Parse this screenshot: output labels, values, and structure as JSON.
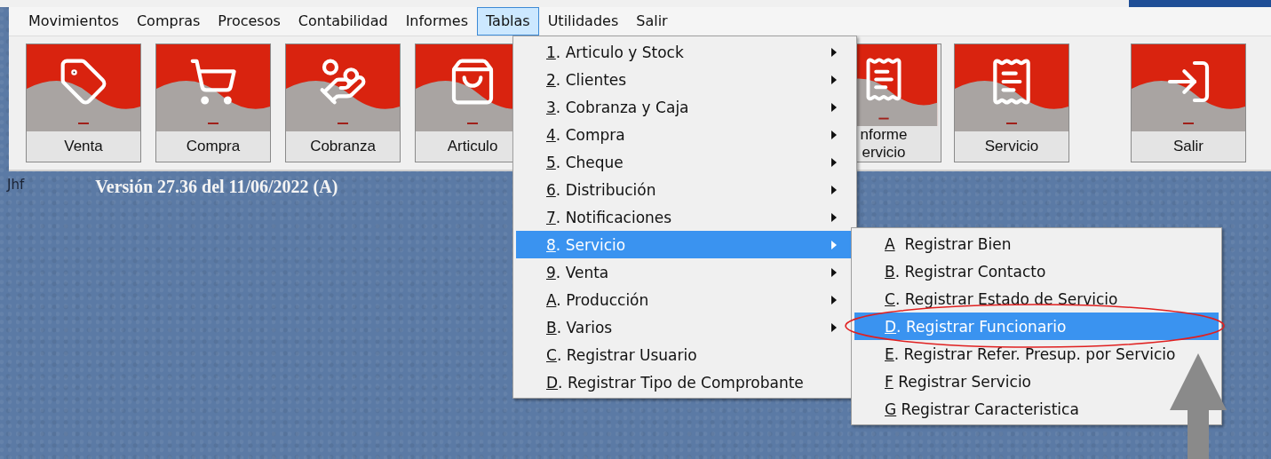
{
  "menu_bar": [
    {
      "label": "Movimientos",
      "selected": false
    },
    {
      "label": "Compras",
      "selected": false
    },
    {
      "label": "Procesos",
      "selected": false
    },
    {
      "label": "Contabilidad",
      "selected": false
    },
    {
      "label": "Informes",
      "selected": false
    },
    {
      "label": "Tablas",
      "selected": true
    },
    {
      "label": "Utilidades",
      "selected": false
    },
    {
      "label": "Salir",
      "selected": false
    }
  ],
  "toolbar": [
    {
      "label": "Venta"
    },
    {
      "label": "Compra"
    },
    {
      "label": "Cobranza"
    },
    {
      "label": "Articulo"
    },
    {
      "label": "nforme\nervicio"
    },
    {
      "label": "Servicio"
    },
    {
      "label": "Salir"
    }
  ],
  "status": {
    "user": "Jhf",
    "version": "Versión 27.36 del 11/06/2022  (A)"
  },
  "tablas_menu": [
    {
      "key": "1",
      "label": ". Articulo y Stock",
      "submenu": true,
      "selected": false
    },
    {
      "key": "2",
      "label": ". Clientes",
      "submenu": true,
      "selected": false
    },
    {
      "key": "3",
      "label": ". Cobranza y Caja",
      "submenu": true,
      "selected": false
    },
    {
      "key": "4",
      "label": ". Compra",
      "submenu": true,
      "selected": false
    },
    {
      "key": "5",
      "label": ". Cheque",
      "submenu": true,
      "selected": false
    },
    {
      "key": "6",
      "label": ". Distribución",
      "submenu": true,
      "selected": false
    },
    {
      "key": "7",
      "label": ". Notificaciones",
      "submenu": true,
      "selected": false
    },
    {
      "key": "8",
      "label": ". Servicio",
      "submenu": true,
      "selected": true
    },
    {
      "key": "9",
      "label": ". Venta",
      "submenu": true,
      "selected": false
    },
    {
      "key": "A",
      "label": ". Producción",
      "submenu": true,
      "selected": false
    },
    {
      "key": "B",
      "label": ". Varios",
      "submenu": true,
      "selected": false
    },
    {
      "key": "C",
      "label": ". Registrar Usuario",
      "submenu": false,
      "selected": false
    },
    {
      "key": "D",
      "label": ". Registrar Tipo de Comprobante",
      "submenu": false,
      "selected": false
    }
  ],
  "servicio_submenu": [
    {
      "key": "A",
      "label": "  Registrar Bien",
      "selected": false
    },
    {
      "key": "B",
      "label": ". Registrar Contacto",
      "selected": false
    },
    {
      "key": "C",
      "label": ". Registrar Estado de Servicio",
      "selected": false
    },
    {
      "key": "D",
      "label": ". Registrar Funcionario",
      "selected": true
    },
    {
      "key": "E",
      "label": ". Registrar Refer. Presup. por Servicio",
      "selected": false
    },
    {
      "key": "F",
      "label": " Registrar Servicio",
      "selected": false
    },
    {
      "key": "G",
      "label": " Registrar Caracteristica",
      "selected": false
    }
  ]
}
